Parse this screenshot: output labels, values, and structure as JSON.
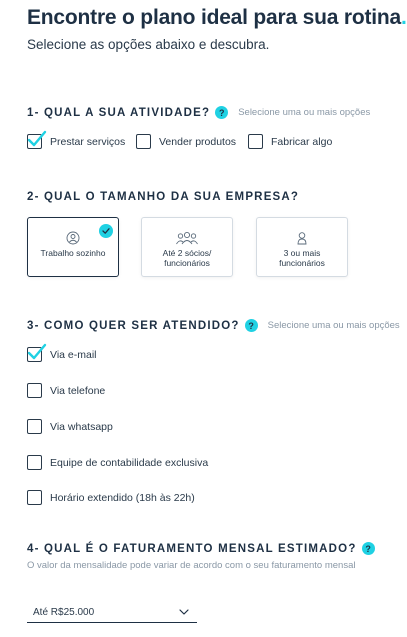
{
  "header": {
    "title": "Encontre o plano ideal para sua rotina",
    "title_dot": ".",
    "subtitle": "Selecione as opções abaixo e descubra."
  },
  "section1": {
    "title": "1- QUAL A SUA ATIVIDADE?",
    "help": "?",
    "hint": "Selecione uma ou mais opções",
    "options": [
      {
        "label": "Prestar serviços",
        "checked": true
      },
      {
        "label": "Vender produtos",
        "checked": false
      },
      {
        "label": "Fabricar algo",
        "checked": false
      }
    ]
  },
  "section2": {
    "title": "2- QUAL O TAMANHO DA SUA EMPRESA?",
    "cards": [
      {
        "label": "Trabalho sozinho",
        "icon": "user-icon",
        "selected": true
      },
      {
        "label": "Até 2 sócios/ funcionários",
        "icon": "group-icon",
        "selected": false
      },
      {
        "label": "3 ou mais funcionários",
        "icon": "user-outline-icon",
        "selected": false
      }
    ]
  },
  "section3": {
    "title": "3- COMO QUER SER ATENDIDO?",
    "help": "?",
    "hint": "Selecione uma ou mais opções",
    "options": [
      {
        "label": "Via e-mail",
        "checked": true
      },
      {
        "label": "Via telefone",
        "checked": false
      },
      {
        "label": "Via whatsapp",
        "checked": false
      },
      {
        "label": "Equipe de contabilidade exclusiva",
        "checked": false
      },
      {
        "label": "Horário extendido (18h às 22h)",
        "checked": false
      }
    ]
  },
  "section4": {
    "title": "4- QUAL É O FATURAMENTO MENSAL ESTIMADO?",
    "help": "?",
    "hint": "O valor da mensalidade pode variar de acordo com o seu faturamento mensal",
    "select_value": "Até R$25.000"
  },
  "colors": {
    "accent": "#1fd1e3",
    "text": "#1e3044"
  }
}
